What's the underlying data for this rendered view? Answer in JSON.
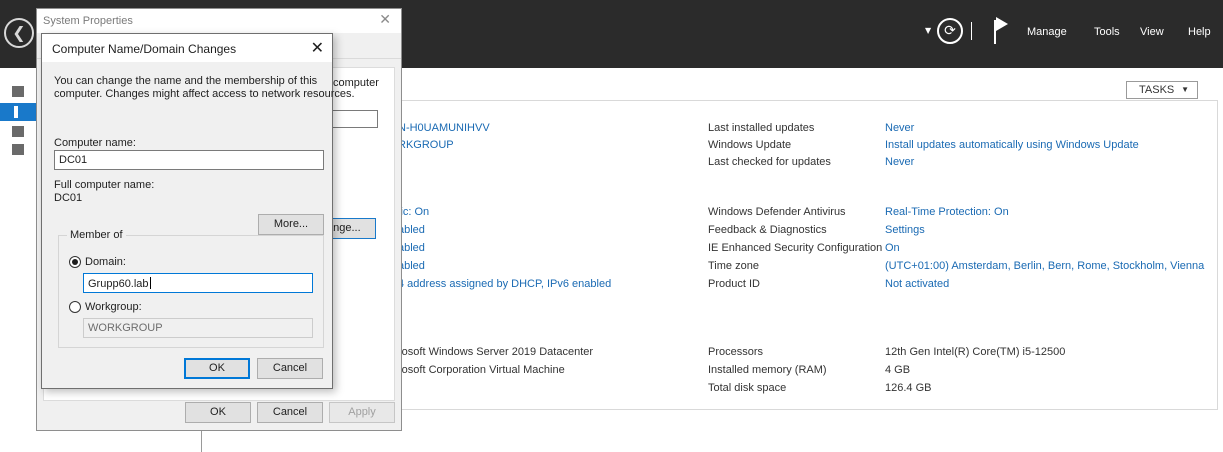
{
  "server_manager": {
    "header": {
      "back_icon": "back-arrow-icon",
      "menu": [
        "Manage",
        "Tools",
        "View",
        "Help"
      ]
    },
    "tasks_label": "TASKS",
    "properties_left": [
      {
        "value": "N-H0UAMUNIHVV"
      },
      {
        "value": "RKGROUP"
      },
      {
        "value": "lic: On"
      },
      {
        "value": "abled"
      },
      {
        "value": "abled"
      },
      {
        "value": "abled"
      },
      {
        "value": "4 address assigned by DHCP, IPv6 enabled"
      },
      {
        "value": "rosoft Windows Server 2019 Datacenter"
      },
      {
        "value": "rosoft Corporation Virtual Machine"
      }
    ],
    "properties_right": [
      {
        "label": "Last installed updates",
        "value": "Never"
      },
      {
        "label": "Windows Update",
        "value": "Install updates automatically using Windows Update"
      },
      {
        "label": "Last checked for updates",
        "value": "Never"
      },
      {
        "label": "Windows Defender Antivirus",
        "value": "Real-Time Protection: On"
      },
      {
        "label": "Feedback & Diagnostics",
        "value": "Settings"
      },
      {
        "label": "IE Enhanced Security Configuration",
        "value": "On"
      },
      {
        "label": "Time zone",
        "value": "(UTC+01:00) Amsterdam, Berlin, Bern, Rome, Stockholm, Vienna"
      },
      {
        "label": "Product ID",
        "value": "Not activated"
      },
      {
        "label": "Processors",
        "value": "12th Gen Intel(R) Core(TM) i5-12500"
      },
      {
        "label": "Installed memory (RAM)",
        "value": "4 GB"
      },
      {
        "label": "Total disk space",
        "value": "126.4 GB"
      }
    ]
  },
  "system_properties": {
    "title": "System Properties",
    "partial_computer_text": "computer",
    "partial_change_button": "ange...",
    "ok_label": "OK",
    "cancel_label": "Cancel",
    "apply_label": "Apply"
  },
  "name_change_dialog": {
    "title": "Computer Name/Domain Changes",
    "description_line1": "You can change the name and the membership of this",
    "description_line2": "computer. Changes might affect access to network resources.",
    "computer_name_label": "Computer name:",
    "computer_name_value": "DC01",
    "full_name_label": "Full computer name:",
    "full_name_value": "DC01",
    "more_label": "More...",
    "member_of_label": "Member of",
    "domain_label": "Domain:",
    "domain_value": "Grupp60.lab",
    "workgroup_label": "Workgroup:",
    "workgroup_value": "WORKGROUP",
    "ok_label": "OK",
    "cancel_label": "Cancel"
  }
}
